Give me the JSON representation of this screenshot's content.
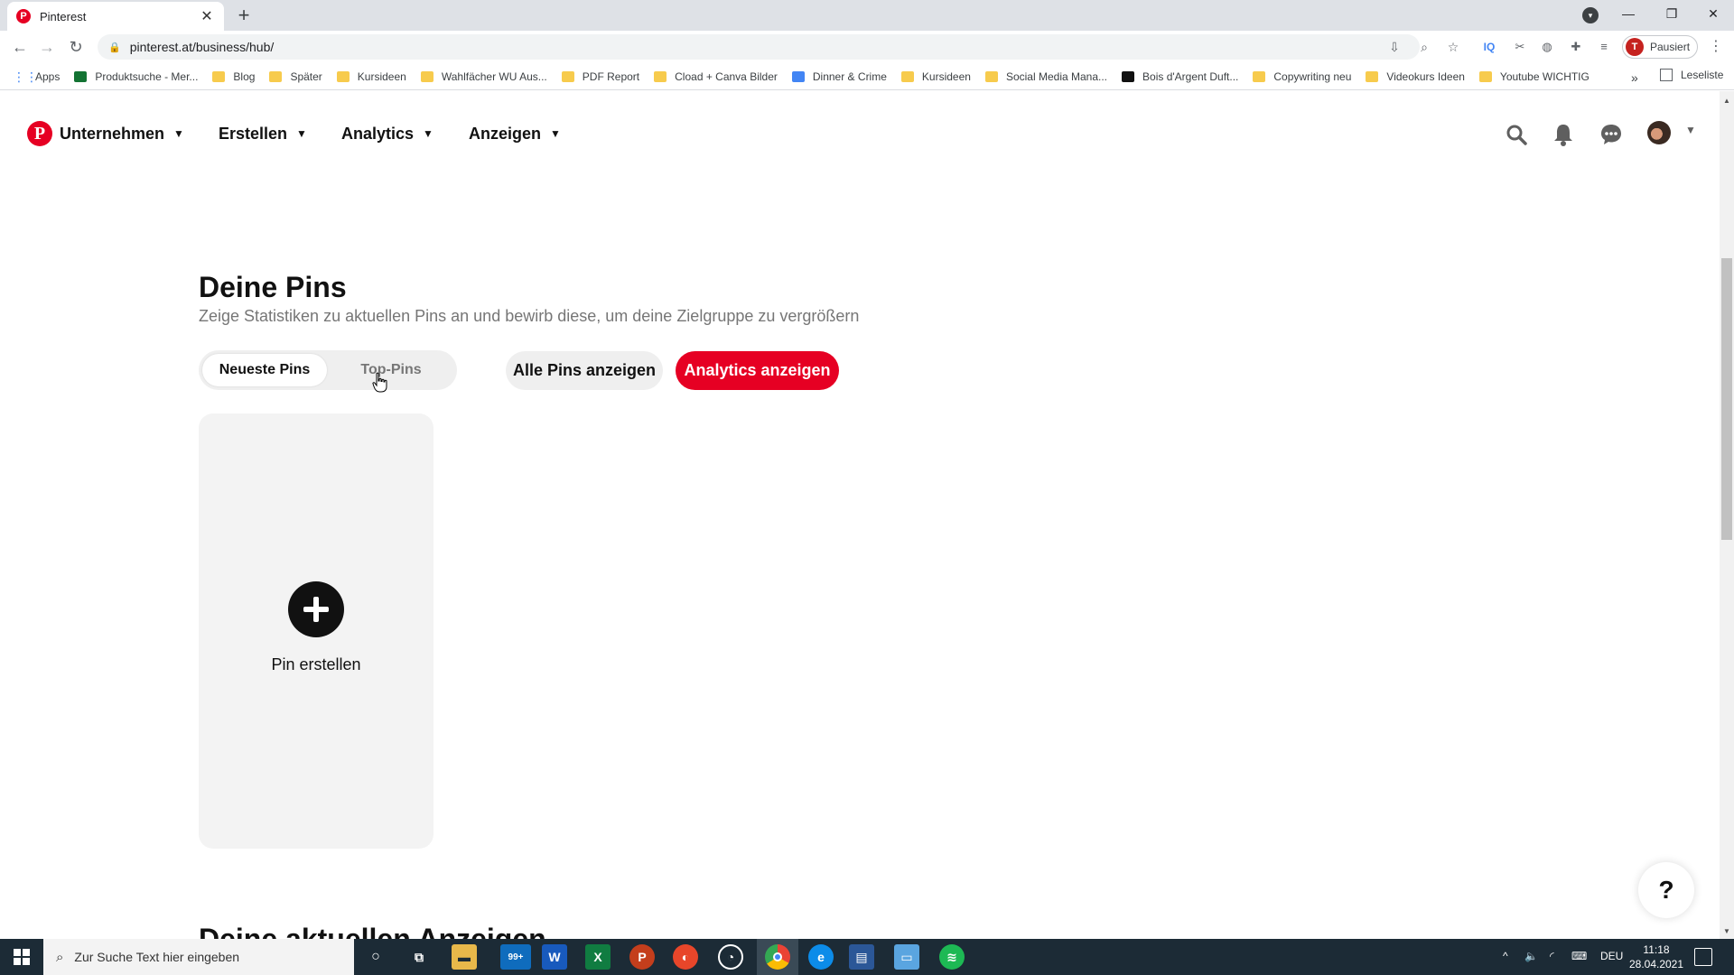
{
  "browser": {
    "tab_title": "Pinterest",
    "tab_favicon": "P",
    "tab_close": "✕",
    "new_tab": "+",
    "url": "pinterest.at/business/hub/",
    "profile_initial": "T",
    "profile_label": "Pausiert",
    "bookmarks": [
      "Apps",
      "Produktsuche - Mer...",
      "Blog",
      "Später",
      "Kursideen",
      "Wahlfächer WU Aus...",
      "PDF Report",
      "Cload + Canva Bilder",
      "Dinner & Crime",
      "Kursideen",
      "Social Media Mana...",
      "Bois d'Argent Duft...",
      "Copywriting neu",
      "Videokurs Ideen",
      "Youtube WICHTIG"
    ],
    "bookmarks_more": "»",
    "reading_list": "Leseliste"
  },
  "nav": {
    "logo": "P",
    "items": [
      "Unternehmen",
      "Erstellen",
      "Analytics",
      "Anzeigen"
    ]
  },
  "main": {
    "title": "Deine Pins",
    "subtitle": "Zeige Statistiken zu aktuellen Pins an und bewirb diese, um deine Zielgruppe zu vergrößern",
    "tabs": [
      "Neueste Pins",
      "Top-Pins"
    ],
    "view_all": "Alle Pins anzeigen",
    "view_analytics": "Analytics anzeigen",
    "create_pin": "Pin erstellen",
    "next_section_title": "Deine aktuellen Anzeigen",
    "help": "?"
  },
  "taskbar": {
    "search_placeholder": "Zur Suche Text hier eingeben",
    "badge": "99+",
    "language": "DEU",
    "time": "11:18",
    "date": "28.04.2021"
  },
  "colors": {
    "pinterest_red": "#e60023",
    "taskbar": "#1c2b36"
  }
}
